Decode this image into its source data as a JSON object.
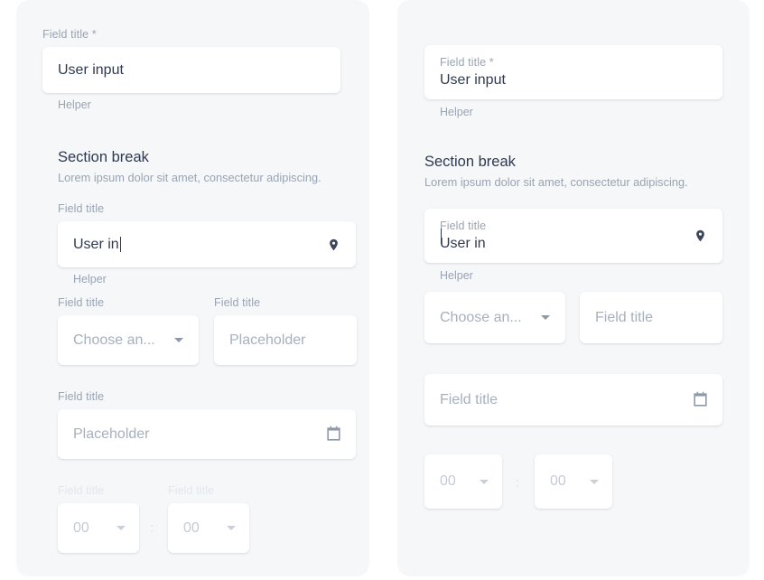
{
  "panels": {
    "left": {
      "name": "outlined-stacked-label-variant",
      "text_field": {
        "label": "Field title *",
        "value": "User input",
        "helper": "Helper"
      },
      "section_break": {
        "title": "Section break",
        "subtitle": "Lorem ipsum dolor sit amet, consectetur adipiscing."
      },
      "location_field": {
        "label": "Field title",
        "value": "User in",
        "helper": "Helper",
        "icon": "map-pin-icon"
      },
      "select_field": {
        "label": "Field title",
        "value": "Choose an...",
        "icon": "chevron-down-icon"
      },
      "text_field_2": {
        "label": "Field title",
        "placeholder": "Placeholder"
      },
      "date_field": {
        "label": "Field title",
        "placeholder": "Placeholder",
        "icon": "calendar-icon"
      },
      "time_hours": {
        "label": "Field title",
        "value": "00",
        "icon": "chevron-down-icon"
      },
      "time_minutes": {
        "label": "Field title",
        "value": "00",
        "icon": "chevron-down-icon"
      },
      "time_separator": ":"
    },
    "right": {
      "name": "filled-inline-label-variant",
      "text_field": {
        "label": "Field title *",
        "value": "User input",
        "helper": "Helper"
      },
      "section_break": {
        "title": "Section break",
        "subtitle": "Lorem ipsum dolor sit amet, consectetur adipiscing."
      },
      "location_field": {
        "label": "Field title",
        "value": "User in",
        "helper": "Helper",
        "icon": "map-pin-icon"
      },
      "select_field": {
        "value": "Choose an...",
        "icon": "chevron-down-icon"
      },
      "text_field_2": {
        "placeholder": "Field title"
      },
      "date_field": {
        "placeholder": "Field title",
        "icon": "calendar-icon"
      },
      "time_hours": {
        "value": "00",
        "icon": "chevron-down-icon"
      },
      "time_minutes": {
        "value": "00",
        "icon": "chevron-down-icon"
      },
      "time_separator": ":"
    }
  },
  "colors": {
    "panel_bg": "#f5f7f9",
    "field_bg": "#ffffff",
    "text_primary": "#2f3a4f",
    "text_secondary": "#9aa4b2",
    "text_placeholder": "#a7b0bd",
    "text_disabled": "#c4cbd5",
    "icon_dark": "#3d4759",
    "icon_grey": "#8e99a8"
  }
}
